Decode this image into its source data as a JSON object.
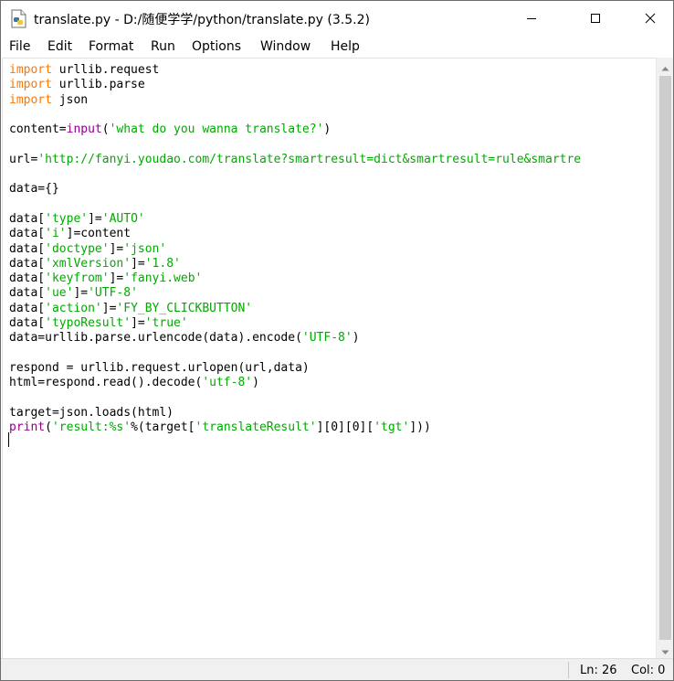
{
  "window": {
    "title": "translate.py - D:/随便学学/python/translate.py (3.5.2)",
    "icon": "python-file-icon",
    "controls": [
      "minimize-icon",
      "maximize-icon",
      "close-icon"
    ]
  },
  "menu": [
    {
      "label": "File"
    },
    {
      "label": "Edit"
    },
    {
      "label": "Format"
    },
    {
      "label": "Run"
    },
    {
      "label": "Options"
    },
    {
      "label": "Window"
    },
    {
      "label": "Help"
    }
  ],
  "editor": {
    "lines": [
      [
        [
          "kw",
          "import"
        ],
        [
          "t",
          " urllib.request"
        ]
      ],
      [
        [
          "kw",
          "import"
        ],
        [
          "t",
          " urllib.parse"
        ]
      ],
      [
        [
          "kw",
          "import"
        ],
        [
          "t",
          " json"
        ]
      ],
      [],
      [
        [
          "t",
          "content="
        ],
        [
          "bi",
          "input"
        ],
        [
          "t",
          "("
        ],
        [
          "str",
          "'what do you wanna translate?'"
        ],
        [
          "t",
          ")"
        ]
      ],
      [],
      [
        [
          "t",
          "url="
        ],
        [
          "str",
          "'http://fanyi.youdao.com/translate?smartresult=dict&smartresult=rule&smartre"
        ]
      ],
      [],
      [
        [
          "t",
          "data={}"
        ]
      ],
      [],
      [
        [
          "t",
          "data["
        ],
        [
          "str",
          "'type'"
        ],
        [
          "t",
          "]="
        ],
        [
          "str",
          "'AUTO'"
        ]
      ],
      [
        [
          "t",
          "data["
        ],
        [
          "str",
          "'i'"
        ],
        [
          "t",
          "]=content"
        ]
      ],
      [
        [
          "t",
          "data["
        ],
        [
          "str",
          "'doctype'"
        ],
        [
          "t",
          "]="
        ],
        [
          "str",
          "'json'"
        ]
      ],
      [
        [
          "t",
          "data["
        ],
        [
          "str",
          "'xmlVersion'"
        ],
        [
          "t",
          "]="
        ],
        [
          "str",
          "'1.8'"
        ]
      ],
      [
        [
          "t",
          "data["
        ],
        [
          "str",
          "'keyfrom'"
        ],
        [
          "t",
          "]="
        ],
        [
          "str",
          "'fanyi.web'"
        ]
      ],
      [
        [
          "t",
          "data["
        ],
        [
          "str",
          "'ue'"
        ],
        [
          "t",
          "]="
        ],
        [
          "str",
          "'UTF-8'"
        ]
      ],
      [
        [
          "t",
          "data["
        ],
        [
          "str",
          "'action'"
        ],
        [
          "t",
          "]="
        ],
        [
          "str",
          "'FY_BY_CLICKBUTTON'"
        ]
      ],
      [
        [
          "t",
          "data["
        ],
        [
          "str",
          "'typoResult'"
        ],
        [
          "t",
          "]="
        ],
        [
          "str",
          "'true'"
        ]
      ],
      [
        [
          "t",
          "data=urllib.parse.urlencode(data).encode("
        ],
        [
          "str",
          "'UTF-8'"
        ],
        [
          "t",
          ")"
        ]
      ],
      [],
      [
        [
          "t",
          "respond = urllib.request.urlopen(url,data)"
        ]
      ],
      [
        [
          "t",
          "html=respond.read().decode("
        ],
        [
          "str",
          "'utf-8'"
        ],
        [
          "t",
          ")"
        ]
      ],
      [],
      [
        [
          "t",
          "target=json.loads(html)"
        ]
      ],
      [
        [
          "bi",
          "print"
        ],
        [
          "t",
          "("
        ],
        [
          "str",
          "'result:%s'"
        ],
        [
          "t",
          "%(target["
        ],
        [
          "str",
          "'translateResult'"
        ],
        [
          "t",
          "][0][0]["
        ],
        [
          "str",
          "'tgt'"
        ],
        [
          "t",
          "]))"
        ]
      ]
    ]
  },
  "status": {
    "line": "Ln: 26",
    "col": "Col: 0"
  },
  "colors": {
    "keyword": "#ff7700",
    "string": "#00aa00",
    "builtin": "#900090"
  }
}
